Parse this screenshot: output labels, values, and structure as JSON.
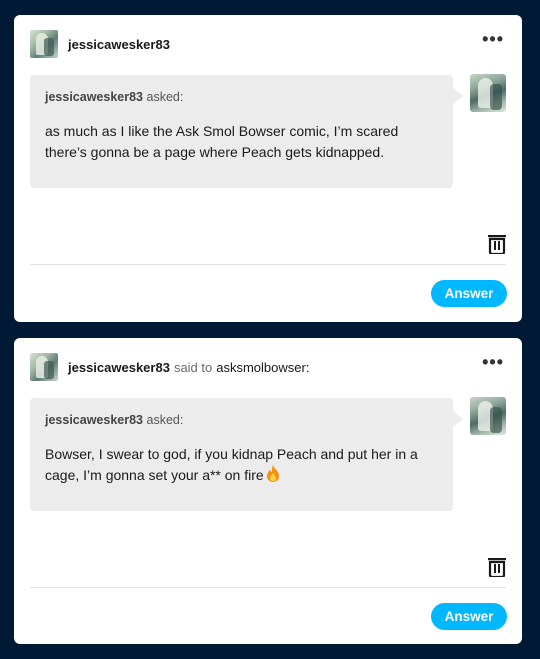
{
  "posts": [
    {
      "username": "jessicawesker83",
      "said": "",
      "target": "",
      "asker_name": "jessicawesker83",
      "asked_suffix": "asked:",
      "question": "as much as I like the Ask Smol Bowser comic, I’m scared there’s gonna be a page where Peach gets kidnapped.",
      "answer_label": "Answer",
      "menu_icon": "more-horizontal-icon",
      "delete_icon": "trash-icon"
    },
    {
      "username": "jessicawesker83",
      "said": "said to",
      "target": "asksmolbowser:",
      "asker_name": "jessicawesker83",
      "asked_suffix": "asked:",
      "question": "Bowser, I swear to god, if you kidnap Peach and put her in a cage, I’m gonna set your a** on fire",
      "answer_label": "Answer",
      "menu_icon": "more-horizontal-icon",
      "delete_icon": "trash-icon"
    }
  ],
  "colors": {
    "background": "#001935",
    "card": "#ffffff",
    "bubble": "#ececec",
    "accent": "#00b8ff"
  }
}
